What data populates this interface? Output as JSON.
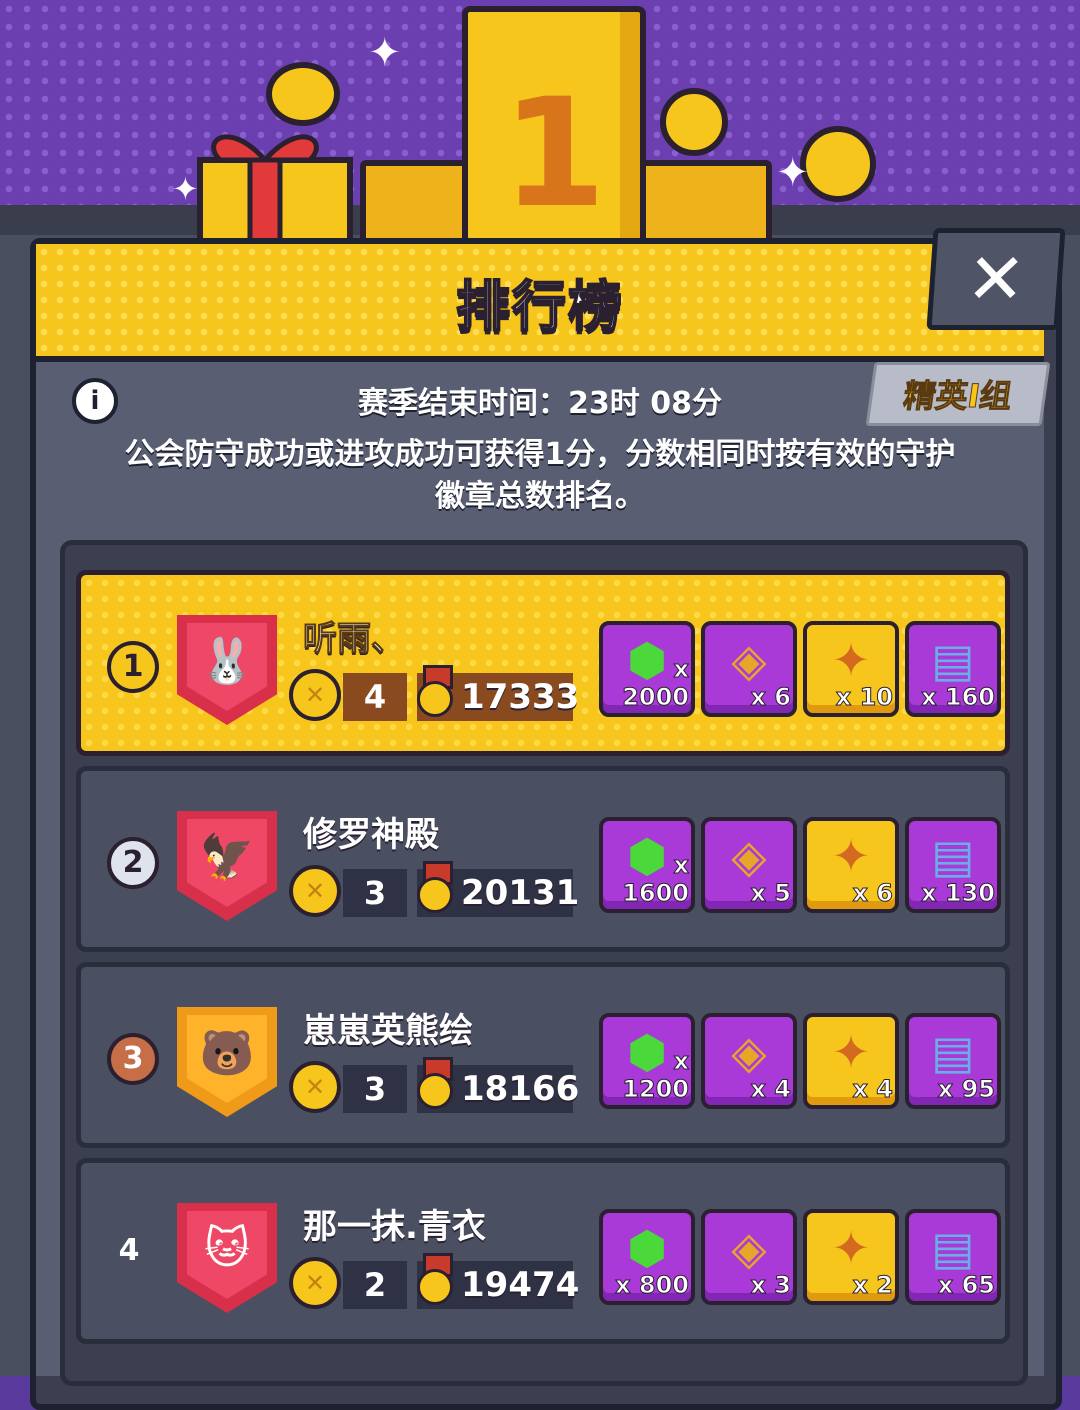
{
  "header": {
    "title": "排行榜",
    "pillar_number": "1",
    "close_label": "✕"
  },
  "season": {
    "end_label": "赛季结束时间：",
    "end_time": "23时 08分",
    "tier": "精英I组",
    "description": "公会防守成功或进攻成功可获得1分，分数相同时按有效的守护徽章总数排名。"
  },
  "rows": [
    {
      "rank": "1",
      "name": "听雨、",
      "members": "4",
      "score": "17333",
      "rewards": [
        "x 2000",
        "x 6",
        "x 10",
        "x 160"
      ]
    },
    {
      "rank": "2",
      "name": "修罗神殿",
      "members": "3",
      "score": "20131",
      "rewards": [
        "x 1600",
        "x 5",
        "x 6",
        "x 130"
      ]
    },
    {
      "rank": "3",
      "name": "崽崽英熊绘",
      "members": "3",
      "score": "18166",
      "rewards": [
        "x 1200",
        "x 4",
        "x 4",
        "x 95"
      ]
    },
    {
      "rank": "4",
      "name": "那一抹.青衣",
      "members": "2",
      "score": "19474",
      "rewards": [
        "x 800",
        "x 3",
        "x 2",
        "x 65"
      ]
    }
  ],
  "icons": {
    "info": "i",
    "gem": "⬢",
    "card": "◈",
    "piece": "✦",
    "stone": "▤",
    "coin": "✕",
    "faces": [
      "🐰",
      "🦅",
      "🐻",
      "🐱"
    ]
  },
  "colors": {
    "accent_gold": "#f7c61c",
    "panel_dark": "#3b3f50",
    "shield_red": "#d8304a",
    "shield_orange": "#f09a1a"
  }
}
